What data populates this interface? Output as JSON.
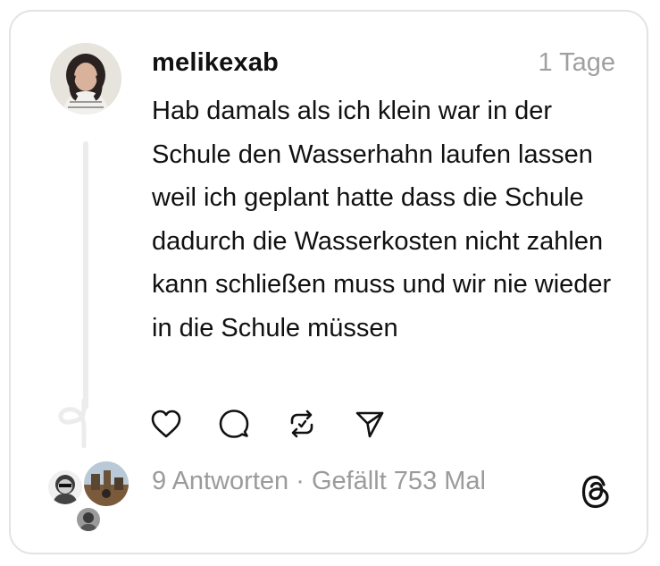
{
  "post": {
    "username": "melikexab",
    "time": "1 Tage",
    "text": "Hab damals als ich klein war in der Schule den Wasserhahn laufen lassen weil ich geplant hatte dass die Schule dadurch die Wasserkosten nicht zahlen kann schließen muss und wir nie wieder in die Schule müssen"
  },
  "actions": [
    {
      "name": "like",
      "icon": "heart-icon"
    },
    {
      "name": "reply",
      "icon": "comment-bubble-icon"
    },
    {
      "name": "repost",
      "icon": "repost-icon"
    },
    {
      "name": "share",
      "icon": "send-icon"
    }
  ],
  "footer": {
    "replies": "9 Antworten",
    "separator": " · ",
    "likes": "Gefällt 753 Mal"
  },
  "icons": {
    "brand": "threads-logo-icon"
  },
  "colors": {
    "text": "#111111",
    "muted": "#9b9b9b",
    "border": "#e3e3e3",
    "thread_line": "#ececec"
  }
}
